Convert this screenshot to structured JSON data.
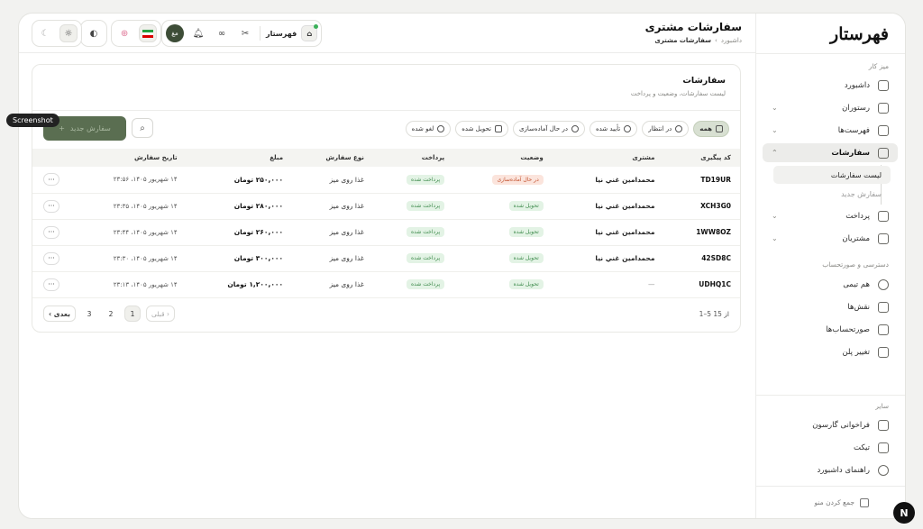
{
  "brand": {
    "logo": "فهرستار"
  },
  "header": {
    "title": "سفارشات مشتری",
    "breadcrumb": [
      "داشبورد",
      "سفارشات مشتری"
    ],
    "store_name": "فهرستار",
    "user_initials": "مغ"
  },
  "sidebar": {
    "section_work": "میز کار",
    "items": [
      {
        "label": "داشبورد",
        "icon": "grid-icon"
      },
      {
        "label": "رستوران",
        "icon": "store-icon"
      },
      {
        "label": "فهرست‌ها",
        "icon": "utensils-icon"
      },
      {
        "label": "سفارشات",
        "icon": "bag-icon"
      },
      {
        "label": "پرداخت",
        "icon": "tag-icon"
      },
      {
        "label": "مشتریان",
        "icon": "contact-icon"
      }
    ],
    "sub_items": [
      "لیست سفارشات",
      "سفارش جدید"
    ],
    "section_access": "دسترسی و صورتحساب",
    "access_items": [
      {
        "label": "هم تیمی",
        "icon": "users-icon"
      },
      {
        "label": "نقش‌ها",
        "icon": "shield-icon"
      },
      {
        "label": "صورتحساب‌ها",
        "icon": "invoice-icon"
      },
      {
        "label": "تغییر پلن",
        "icon": "crown-icon"
      }
    ],
    "section_other": "سایر",
    "other_items": [
      {
        "label": "فراخوانی گارسون",
        "icon": "bell-icon"
      },
      {
        "label": "تیکت",
        "icon": "ticket-icon"
      },
      {
        "label": "راهنمای داشبورد",
        "icon": "help-icon"
      }
    ],
    "collapse_label": "جمع کردن منو"
  },
  "card": {
    "title": "سفارشات",
    "subtitle": "لیست سفارشات، وضعیت و پرداخت",
    "new_order": "سفارش جدید",
    "filters": [
      "همه",
      "در انتظار",
      "تأیید شده",
      "در حال آماده‌سازی",
      "تحویل شده",
      "لغو شده"
    ]
  },
  "table": {
    "headers": {
      "code": "کد پیگیری",
      "customer": "مشتری",
      "status": "وضعیت",
      "payment": "پرداخت",
      "type": "نوع سفارش",
      "amount": "مبلغ",
      "date": "تاریخ سفارش"
    },
    "rows": [
      {
        "code": "TD19UR",
        "customer": "محمدامين غني نيا",
        "status": "در حال آماده‌سازی",
        "status_color": "red",
        "payment": "پرداخت شده",
        "type": "غذا روی میز",
        "amount": "۲۵۰,۰۰۰ تومان",
        "date": "۱۴ شهریور ۱۴۰۵، ۲۳:۵۶"
      },
      {
        "code": "XCH3G0",
        "customer": "محمدامين غني نيا",
        "status": "تحویل شده",
        "status_color": "green",
        "payment": "پرداخت شده",
        "type": "غذا روی میز",
        "amount": "۲۸۰,۰۰۰ تومان",
        "date": "۱۴ شهریور ۱۴۰۵، ۲۳:۳۵"
      },
      {
        "code": "1WW8OZ",
        "customer": "محمدامين غني نيا",
        "status": "تحویل شده",
        "status_color": "green",
        "payment": "پرداخت شده",
        "type": "غذا روی میز",
        "amount": "۲۶۰,۰۰۰ تومان",
        "date": "۱۴ شهریور ۱۴۰۵، ۲۳:۴۴"
      },
      {
        "code": "42SD8C",
        "customer": "محمدامين غني نيا",
        "status": "تحویل شده",
        "status_color": "green",
        "payment": "پرداخت شده",
        "type": "غذا روی میز",
        "amount": "۳۰۰,۰۰۰ تومان",
        "date": "۱۴ شهریور ۱۴۰۵، ۲۳:۳۰"
      },
      {
        "code": "UDHQ1C",
        "customer": "—",
        "status": "تحویل شده",
        "status_color": "green",
        "payment": "پرداخت شده",
        "type": "غذا روی میز",
        "amount": "۱,۲۰۰,۰۰۰ تومان",
        "date": "۱۴ شهریور ۱۴۰۵، ۲۳:۱۳"
      }
    ]
  },
  "pagination": {
    "range": "1–5 از 15",
    "prev": "قبلی",
    "next": "بعدی",
    "pages": [
      "1",
      "2",
      "3"
    ]
  },
  "overlay": {
    "tooltip": "Screenshot",
    "badge": "N"
  }
}
